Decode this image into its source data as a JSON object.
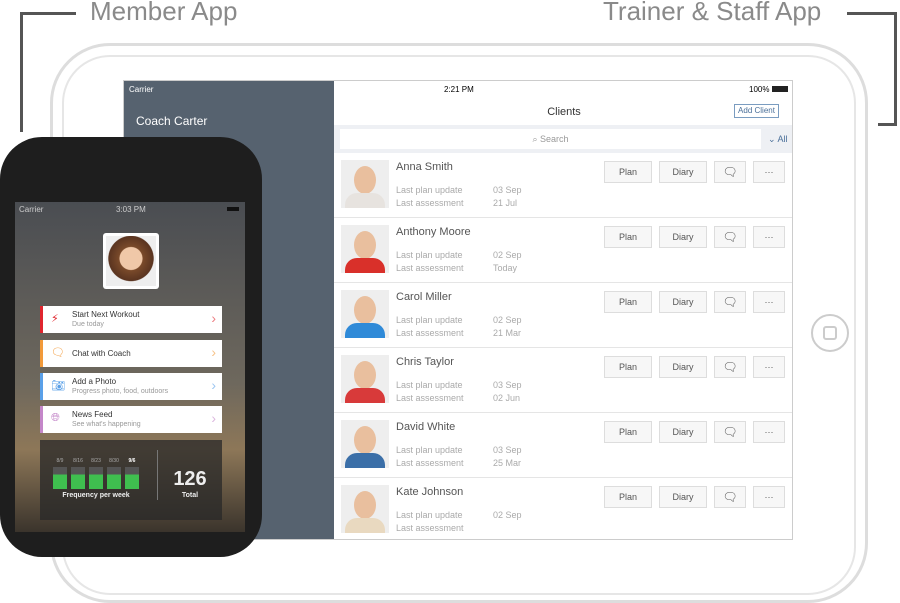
{
  "labels": {
    "member": "Member App",
    "trainer": "Trainer & Staff App"
  },
  "ipad": {
    "status": {
      "carrier": "Carrier",
      "time": "2:21 PM",
      "battery": "100%"
    },
    "sidebar": {
      "user": "Coach Carter"
    },
    "header": {
      "title": "Clients",
      "add_button": "Add Client"
    },
    "search": {
      "placeholder": "Search",
      "filter": "All"
    },
    "row_labels": {
      "plan_update": "Last plan update",
      "assessment": "Last assessment"
    },
    "buttons": {
      "plan": "Plan",
      "diary": "Diary",
      "more": "···"
    },
    "clients": [
      {
        "name": "Anna Smith",
        "plan": "03 Sep",
        "assess": "21 Jul",
        "shirt": "#e7e3df"
      },
      {
        "name": "Anthony Moore",
        "plan": "02 Sep",
        "assess": "Today",
        "shirt": "#d9302a"
      },
      {
        "name": "Carol Miller",
        "plan": "02 Sep",
        "assess": "21 Mar",
        "shirt": "#2f8ad8"
      },
      {
        "name": "Chris Taylor",
        "plan": "03 Sep",
        "assess": "02 Jun",
        "shirt": "#d83a3a"
      },
      {
        "name": "David White",
        "plan": "03 Sep",
        "assess": "25 Mar",
        "shirt": "#3b6fa8"
      },
      {
        "name": "Kate Johnson",
        "plan": "02 Sep",
        "assess": "",
        "shirt": "#e9d9c0"
      }
    ]
  },
  "phone": {
    "status": {
      "carrier": "Carrier",
      "time": "3:03 PM"
    },
    "cards": [
      {
        "title": "Start Next Workout",
        "sub": "Due today",
        "color": "#e0262e",
        "icon": "lightning-icon"
      },
      {
        "title": "Chat with Coach",
        "sub": "",
        "color": "#f29a3a",
        "icon": "chat-icon"
      },
      {
        "title": "Add a Photo",
        "sub": "Progress photo, food, outdoors",
        "color": "#5aa0e8",
        "icon": "camera-icon"
      },
      {
        "title": "News Feed",
        "sub": "See what's happening",
        "color": "#c487c9",
        "icon": "globe-icon"
      }
    ],
    "stats": {
      "weeks": [
        "8/9",
        "8/16",
        "8/23",
        "8/30",
        "9/6"
      ],
      "freq_label": "Frequency per week",
      "total": "126",
      "total_label": "Total"
    }
  }
}
